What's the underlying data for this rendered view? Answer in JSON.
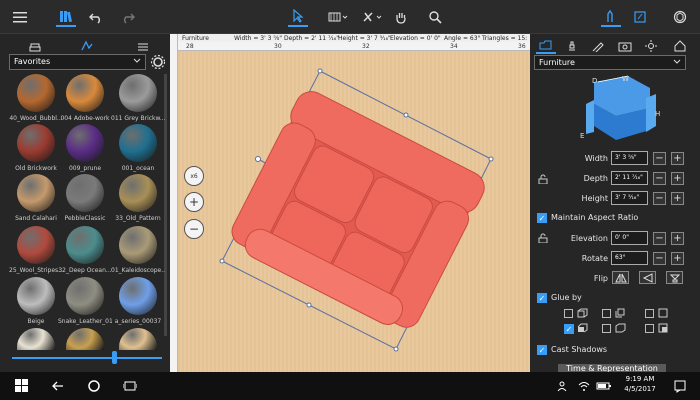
{
  "toolbar": {
    "icons": [
      "menu-icon",
      "library-icon",
      "undo-icon",
      "redo-icon",
      "select-icon",
      "view-icon",
      "snap-icon",
      "pan-icon",
      "search-icon",
      "properties-icon",
      "notes-icon",
      "3d-view-icon"
    ]
  },
  "left_panel": {
    "tabs": [
      "furniture-tab",
      "materials-tab",
      "list-tab"
    ],
    "category": "Favorites",
    "materials": [
      {
        "label": "40_Wood_Bubbl...",
        "color": "#b5682f"
      },
      {
        "label": "004 Adobe-work",
        "color": "#d98a3c"
      },
      {
        "label": "011 Grey Brickw...",
        "color": "#9b9b9b"
      },
      {
        "label": "Old Brickwork",
        "color": "#9b3b30"
      },
      {
        "label": "009_prune",
        "color": "#5a2c86"
      },
      {
        "label": "001_ocean",
        "color": "#1f6f8f"
      },
      {
        "label": "Sand Calahari",
        "color": "#c49a6c"
      },
      {
        "label": "PebbleClassic",
        "color": "#7a7a7a"
      },
      {
        "label": "33_Old_Pattern",
        "color": "#a88f56"
      },
      {
        "label": "25_Wool_Stripes...",
        "color": "#b14a3e"
      },
      {
        "label": "32_Deep Ocean...",
        "color": "#4c8d8c"
      },
      {
        "label": "01_Kaleidoscope...",
        "color": "#aa9b77"
      },
      {
        "label": "Beige",
        "color": "#bdbdbd"
      },
      {
        "label": "Snake_Leather_01",
        "color": "#8e8e82"
      },
      {
        "label": "a_series_00037",
        "color": "#6f9fe8"
      },
      {
        "label": "",
        "color": "#e8e2d2"
      },
      {
        "label": "",
        "color": "#c8a050"
      },
      {
        "label": "",
        "color": "#e0c090"
      }
    ]
  },
  "canvas": {
    "info": {
      "name": "Furniture",
      "width": "Width = 3' 3 ⅝\"",
      "depth": "Depth = 2' 11 ⁷⁄₁₆\"",
      "height": "Height = 3' 7 ⁵⁄₁₆\"",
      "elevation": "Elevation = 0' 0\"",
      "angle": "Angle = 63°",
      "triangles": "Triangles = 15:"
    },
    "ruler": [
      "28",
      "30",
      "32",
      "34",
      "36"
    ],
    "zoom": {
      "scale": "x6",
      "in": "+",
      "out": "−"
    },
    "chair_color": "#ef6a5e"
  },
  "right_panel": {
    "category": "Furniture",
    "preview_labels": {
      "d": "D",
      "w": "W",
      "h": "H",
      "e": "E"
    },
    "dimensions": [
      {
        "label": "Width",
        "value": "3' 3 ⅝\""
      },
      {
        "label": "Depth",
        "value": "2' 11 ⁷⁄₁₆\""
      },
      {
        "label": "Height",
        "value": "3' 7 ⁵⁄₁₆\""
      }
    ],
    "maintain_aspect": "Maintain Aspect Ratio",
    "elevation": {
      "label": "Elevation",
      "value": "0' 0\""
    },
    "rotate": {
      "label": "Rotate",
      "value": "63°"
    },
    "flip_label": "Flip",
    "glue_label": "Glue by",
    "cast_shadows": "Cast Shadows",
    "time_button": "Time & Representation",
    "accent": "#3a9df5"
  },
  "taskbar": {
    "time": "9:19 AM",
    "date": "4/5/2017"
  }
}
